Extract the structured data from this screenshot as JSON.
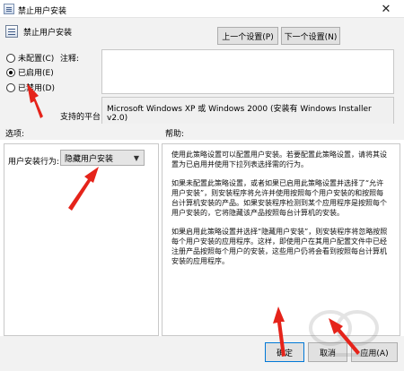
{
  "window": {
    "title": "禁止用户安装",
    "close_glyph": "✕"
  },
  "header": {
    "setting_title": "禁止用户安装",
    "prev_button": "上一个设置(P)",
    "next_button": "下一个设置(N)"
  },
  "state": {
    "options": [
      {
        "label": "未配置(C)",
        "checked": false
      },
      {
        "label": "已启用(E)",
        "checked": true
      },
      {
        "label": "已禁用(D)",
        "checked": false
      }
    ]
  },
  "comment": {
    "label": "注释:",
    "value": ""
  },
  "platform": {
    "label": "支持的平台:",
    "value": "Microsoft Windows XP 或 Windows 2000 (安装有 Windows Installer v2.0)"
  },
  "sections": {
    "options_label": "选项:",
    "help_label": "帮助:"
  },
  "options_pane": {
    "policy_label": "用户安装行为:",
    "dropdown_value": "隐藏用户安装"
  },
  "help": {
    "paragraphs": [
      "使用此策略设置可以配置用户安装。若要配置此策略设置，请将其设置为已启用并使用下拉列表选择需的行为。",
      "如果未配置此策略设置，或者如果已启用此策略设置并选择了“允许用户安装”，则安装程序将允许并使用按照每个用户安装的和按照每台计算机安装的产品。如果安装程序检测到某个应用程序是按照每个用户安装的，它将隐藏该产品按照每台计算机的安装。",
      "如果启用此策略设置并选择“隐藏用户安装”，则安装程序将忽略按照每个用户安装的应用程序。这样，即使用户在其用户配置文件中已经注册产品按照每个用户的安装，这些用户仍将会看到按照每台计算机安装的应用程序。"
    ]
  },
  "footer": {
    "ok": "确定",
    "cancel": "取消",
    "apply": "应用(A)"
  },
  "colors": {
    "arrow": "#e5231a",
    "window_bg": "#f2f2f2",
    "focus_border": "#0078d7"
  }
}
